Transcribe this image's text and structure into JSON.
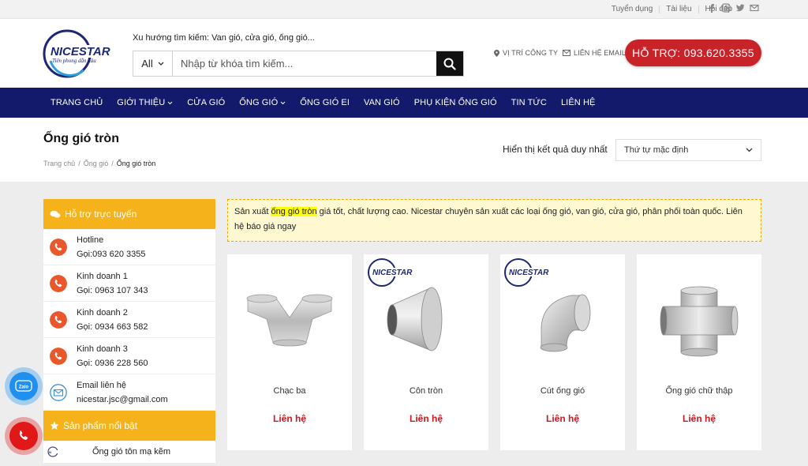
{
  "topbar": {
    "links": [
      "Tuyển dụng",
      "Tài liệu",
      "Hỏi đáp"
    ],
    "social_icons": [
      "facebook-icon",
      "instagram-icon",
      "twitter-icon",
      "email-icon"
    ]
  },
  "header": {
    "logo_text": "NICESTAR",
    "logo_tagline": "Tiên phong dẫn đầu",
    "search_hint": "Xu hướng tìm kiếm: Van gió, cửa gió, ống gió...",
    "search_category": "All",
    "search_placeholder": "Nhập từ khóa tìm kiếm...",
    "location_link": "VỊ TRÍ CÔNG TY",
    "email_link": "LIÊN HỆ EMAIL",
    "hotline_button": "HỖ TRỢ: 093.620.3355"
  },
  "nav": [
    {
      "label": "TRANG CHỦ",
      "dropdown": false
    },
    {
      "label": "GIỚI THIỆU",
      "dropdown": true
    },
    {
      "label": "CỬA GIÓ",
      "dropdown": false
    },
    {
      "label": "ỐNG GIÓ",
      "dropdown": true
    },
    {
      "label": "ỐNG GIÓ EI",
      "dropdown": false
    },
    {
      "label": "VAN GIÓ",
      "dropdown": false
    },
    {
      "label": "PHỤ KIỆN ỐNG GIÓ",
      "dropdown": false
    },
    {
      "label": "TIN TỨC",
      "dropdown": false
    },
    {
      "label": "LIÊN HỆ",
      "dropdown": false
    }
  ],
  "page": {
    "title": "Ống gió tròn",
    "breadcrumb": [
      "Trang chủ",
      "Ống gió",
      "Ống gió tròn"
    ],
    "result_text": "Hiển thị kết quả duy nhất",
    "sort_value": "Thứ tự mặc định"
  },
  "sidebar": {
    "support_title": "Hỗ trợ trực tuyến",
    "contacts": [
      {
        "name": "Hotline",
        "detail": "Gọi:093 620 3355",
        "icon": "phone-icon"
      },
      {
        "name": "Kinh doanh 1",
        "detail": "Gọi: 0963 107 343",
        "icon": "phone-icon"
      },
      {
        "name": "Kinh doanh 2",
        "detail": "Gọi: 0934 663 582",
        "icon": "phone-icon"
      },
      {
        "name": "Kinh doanh 3",
        "detail": "Gọi: 0936 228 560",
        "icon": "phone-icon"
      },
      {
        "name": "Email liên hệ",
        "detail": "nicestar.jsc@gmail.com",
        "icon": "mail-icon"
      }
    ],
    "featured_title": "Sản phẩm nổi bật",
    "featured_items": [
      "Ống gió tôn mạ kẽm"
    ]
  },
  "notice": {
    "before": "Sản xuất ",
    "highlight": "ống gió tròn",
    "after": " giá tốt, chất lượng cao. Nicestar chuyên sản xuất các loại ống gió, van gió, cửa gió, phân phối toàn quốc. Liên hệ báo giá ngay"
  },
  "products": [
    {
      "name": "Chạc ba",
      "price": "Liên hệ"
    },
    {
      "name": "Côn tròn",
      "price": "Liên hệ"
    },
    {
      "name": "Cút ống gió",
      "price": "Liên hệ"
    },
    {
      "name": "Ống gió chữ thập",
      "price": "Liên hệ"
    }
  ],
  "floating": {
    "zalo_label": "Zalo"
  },
  "colors": {
    "nav_bg": "#131a6b",
    "accent_yellow": "#f5b21b",
    "hotline_red": "#c9232a",
    "price_red": "#d0191e"
  }
}
